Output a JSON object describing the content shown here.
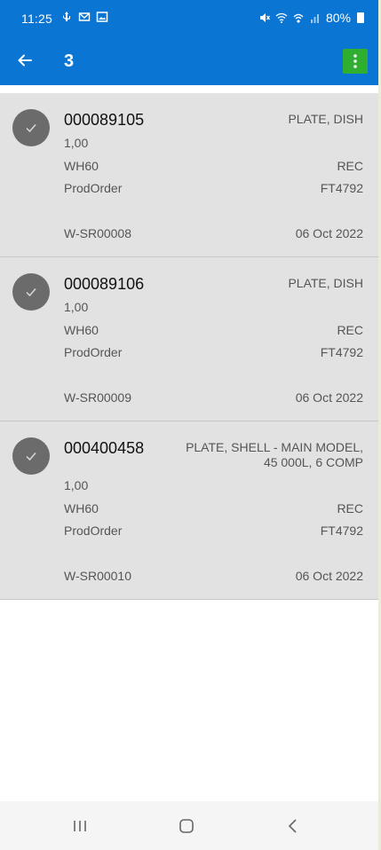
{
  "status": {
    "time": "11:25",
    "battery": "80%",
    "left_icons": [
      "usb-icon",
      "mail-icon",
      "gallery-icon"
    ],
    "right_icons": [
      "mute-icon",
      "wifi-icon",
      "wifi-calling-icon",
      "signal-icon",
      "battery-icon"
    ]
  },
  "header": {
    "title": "3",
    "back_icon": "arrow-left-icon",
    "menu_icon": "more-vertical-icon",
    "colors": {
      "bar": "#0b75d4",
      "menu": "#2fae2f"
    }
  },
  "items": [
    {
      "id": "000089105",
      "description": [
        "PLATE, DISH"
      ],
      "quantity": "1,00",
      "warehouse": "WH60",
      "status": "REC",
      "type": "ProdOrder",
      "order": "FT4792",
      "doc": "W-SR00008",
      "date": "06 Oct 2022"
    },
    {
      "id": "000089106",
      "description": [
        "PLATE, DISH"
      ],
      "quantity": "1,00",
      "warehouse": "WH60",
      "status": "REC",
      "type": "ProdOrder",
      "order": "FT4792",
      "doc": "W-SR00009",
      "date": "06 Oct 2022"
    },
    {
      "id": "000400458",
      "description": [
        "PLATE, SHELL - MAIN MODEL,",
        "45 000L, 6 COMP"
      ],
      "quantity": "1,00",
      "warehouse": "WH60",
      "status": "REC",
      "type": "ProdOrder",
      "order": "FT4792",
      "doc": "W-SR00010",
      "date": "06 Oct 2022"
    }
  ],
  "navbar": {
    "icons": [
      "recent-apps-icon",
      "home-icon",
      "back-icon"
    ]
  }
}
